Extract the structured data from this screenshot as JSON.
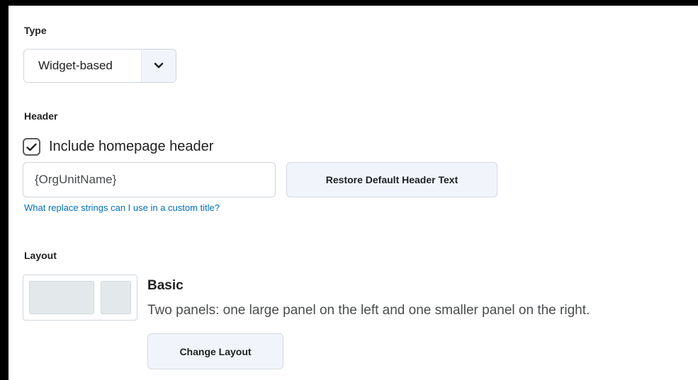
{
  "type_section": {
    "label": "Type",
    "select_value": "Widget-based",
    "arrow_icon": "chevron-down-icon"
  },
  "header_section": {
    "label": "Header",
    "checkbox_checked": true,
    "checkbox_label": "Include homepage header",
    "input_value": "{OrgUnitName}",
    "restore_button_label": "Restore Default Header Text",
    "help_link_text": "What replace strings can I use in a custom title?"
  },
  "layout_section": {
    "label": "Layout",
    "layout_name": "Basic",
    "layout_description": "Two panels: one large panel on the left and one smaller panel on the right.",
    "change_button_label": "Change Layout"
  },
  "colors": {
    "background": "#ffffff",
    "frame": "#000000",
    "link": "#006fbf",
    "button_bg": "#f1f5fb",
    "border": "#cdd5dc",
    "thumb_panel": "#e3e9ea"
  }
}
